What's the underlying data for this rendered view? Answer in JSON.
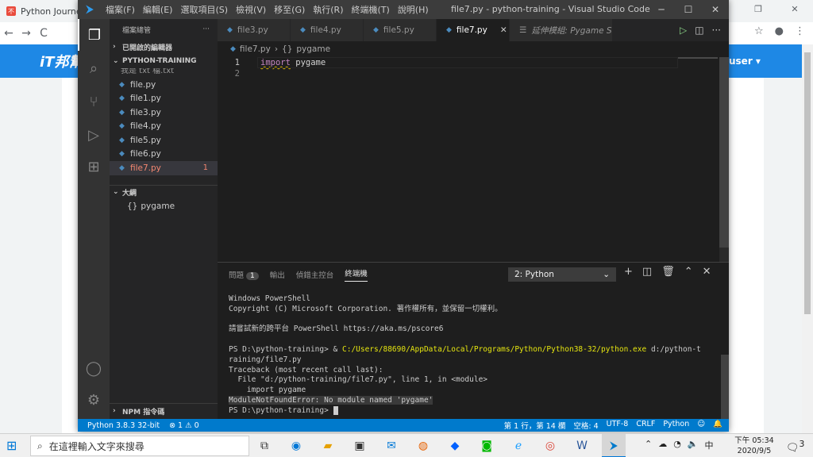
{
  "browser": {
    "tab_title": "Python Journe",
    "favicon": "不",
    "site_logo": "iT邦幫",
    "site_user": "user ▾",
    "nav_back": "←",
    "nav_forward": "→",
    "nav_reload": "C"
  },
  "window": {
    "title": "file7.py - python-training - Visual Studio Code",
    "menu": [
      "檔案(F)",
      "編輯(E)",
      "選取項目(S)",
      "檢視(V)",
      "移至(G)",
      "執行(R)",
      "終端機(T)",
      "說明(H)"
    ]
  },
  "sidebar": {
    "header": "檔案總管",
    "open_editors": "已開啟的編輯器",
    "workspace": "PYTHON-TRAINING",
    "txt_file": "我是 txt 檔.txt",
    "files": [
      {
        "name": "file.py"
      },
      {
        "name": "file1.py"
      },
      {
        "name": "file3.py"
      },
      {
        "name": "file4.py"
      },
      {
        "name": "file5.py"
      },
      {
        "name": "file6.py"
      },
      {
        "name": "file7.py",
        "badge": "1"
      }
    ],
    "outline": "大綱",
    "outline_item": "pygame",
    "npm": "NPM 指令碼"
  },
  "tabs": [
    {
      "label": "file3.py"
    },
    {
      "label": "file4.py"
    },
    {
      "label": "file5.py"
    },
    {
      "label": "file7.py"
    },
    {
      "label": "延伸模組: Pygame Snippets"
    }
  ],
  "breadcrumb": {
    "file": "file7.py",
    "symbol": "pygame"
  },
  "editor": {
    "lines": [
      {
        "num": "1",
        "keyword": "import",
        "rest": " pygame"
      },
      {
        "num": "2",
        "keyword": "",
        "rest": ""
      }
    ]
  },
  "panel": {
    "tabs": [
      "問題",
      "輸出",
      "偵錯主控台",
      "終端機"
    ],
    "problems_badge": "1",
    "terminal_select": "2: Python",
    "terminal": {
      "l1": "Windows PowerShell",
      "l2": "Copyright (C) Microsoft Corporation. 著作權所有，並保留一切權利。",
      "l3": "請嘗試新的跨平台 PowerShell https://aka.ms/pscore6",
      "prompt1": "PS D:\\python-training> & ",
      "exe": "C:/Users/88690/AppData/Local/Programs/Python/Python38-32/python.exe",
      "args": " d:/python-t",
      "wrap": "raining/file7.py",
      "tb1": "Traceback (most recent call last):",
      "tb2": "  File \"d:/python-training/file7.py\", line 1, in <module>",
      "tb3": "    import pygame",
      "err": "ModuleNotFoundError: No module named 'pygame'",
      "prompt2": "PS D:\\python-training> "
    }
  },
  "statusbar": {
    "python": "Python 3.8.3 32-bit",
    "problems": "⊗ 1 ⚠ 0",
    "position": "第 1 行，第 14 欄",
    "spaces": "空格: 4",
    "encoding": "UTF-8",
    "eol": "CRLF",
    "language": "Python"
  },
  "taskbar": {
    "search_placeholder": "在這裡輸入文字來搜尋",
    "clock_time": "下午 05:34",
    "clock_date": "2020/9/5",
    "ime": "中",
    "notif_count": "3"
  }
}
